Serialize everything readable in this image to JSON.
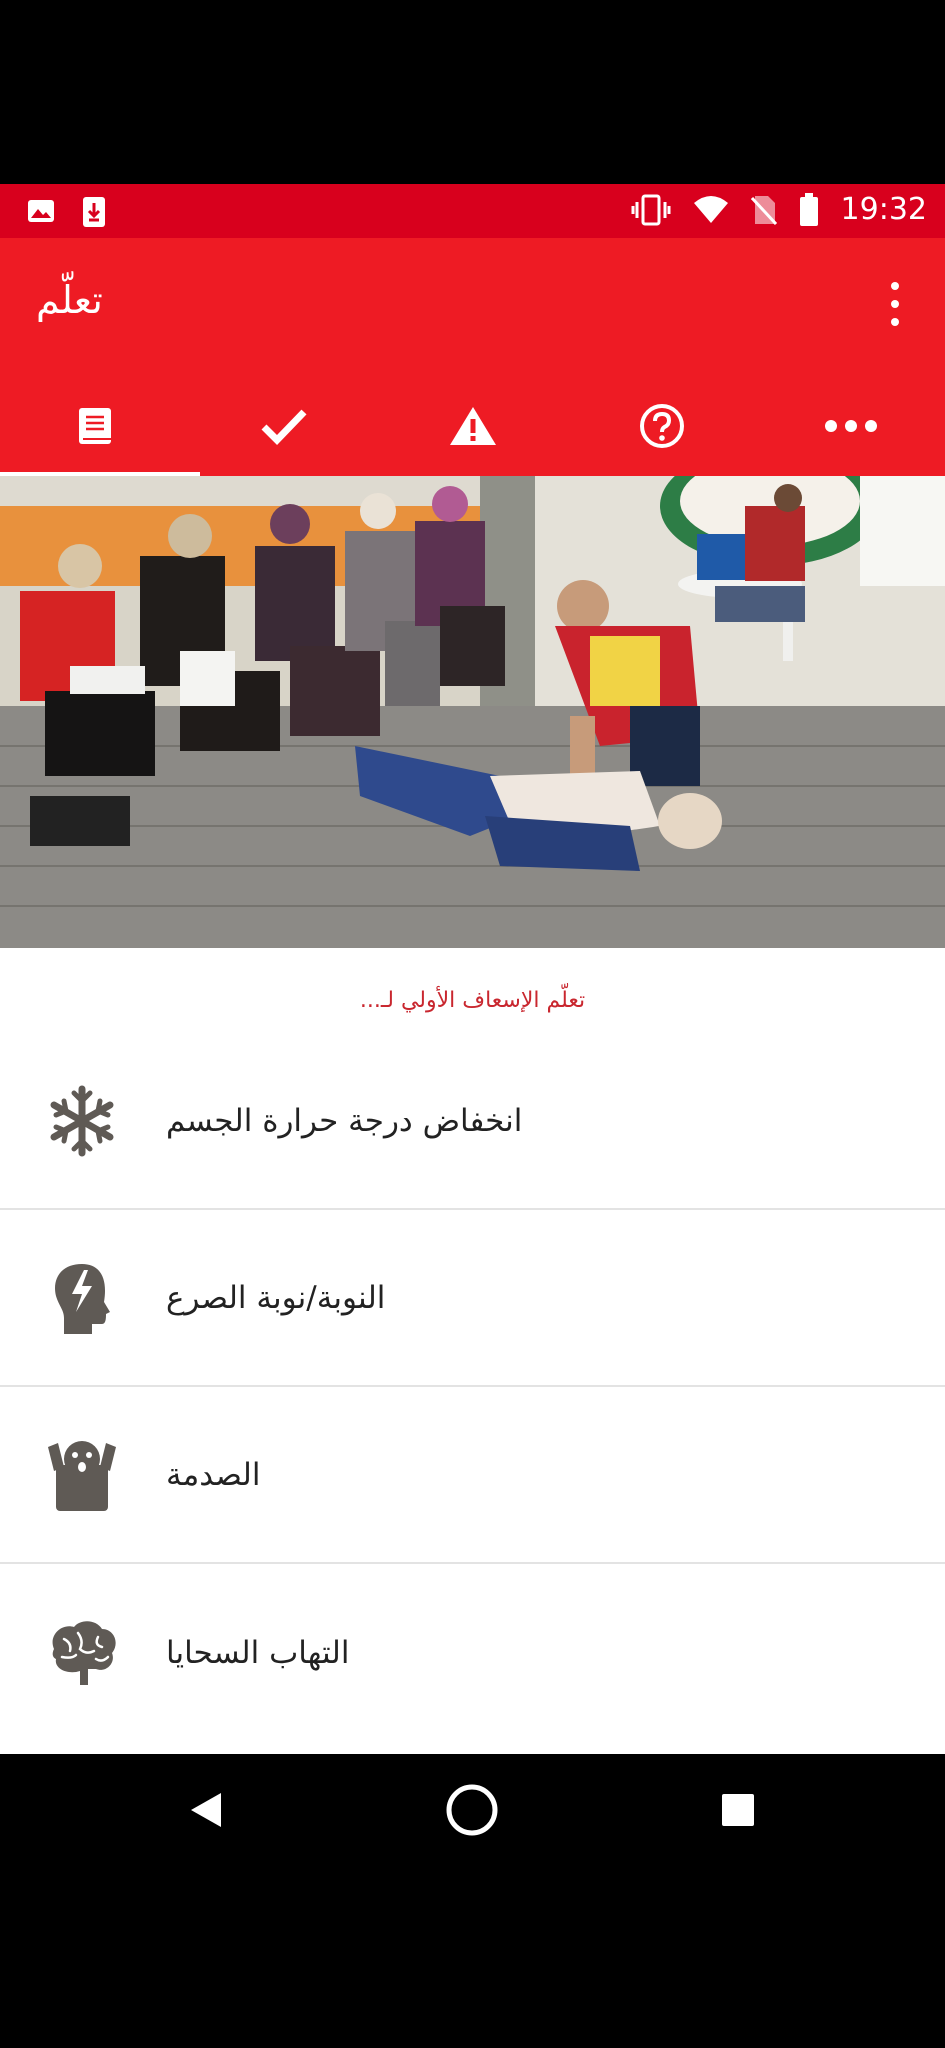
{
  "status_bar": {
    "time": "19:32",
    "bg_color": "#d8001d"
  },
  "app_bar": {
    "title": "تعلّم",
    "bg_color": "#ee1b24"
  },
  "tabs": [
    {
      "icon": "book-icon",
      "selected": true
    },
    {
      "icon": "checkmark-icon",
      "selected": false
    },
    {
      "icon": "warning-icon",
      "selected": false
    },
    {
      "icon": "help-circle-icon",
      "selected": false
    },
    {
      "icon": "more-horizontal-icon",
      "selected": false
    }
  ],
  "hero": {
    "icon": "first-aid-training-photo"
  },
  "content": {
    "subtitle": "تعلّم الإسعاف الأولي لـ...",
    "items": [
      {
        "label": "انخفاض درجة حرارة الجسم",
        "icon": "snowflake-icon"
      },
      {
        "label": "النوبة/نوبة الصرع",
        "icon": "head-lightning-icon"
      },
      {
        "label": "الصدمة",
        "icon": "shocked-face-icon"
      },
      {
        "label": "التهاب السحايا",
        "icon": "brain-icon"
      }
    ]
  },
  "colors": {
    "accent": "#ee1b24",
    "subtitle": "#c9272f",
    "icon_gray": "#5f5a55"
  }
}
